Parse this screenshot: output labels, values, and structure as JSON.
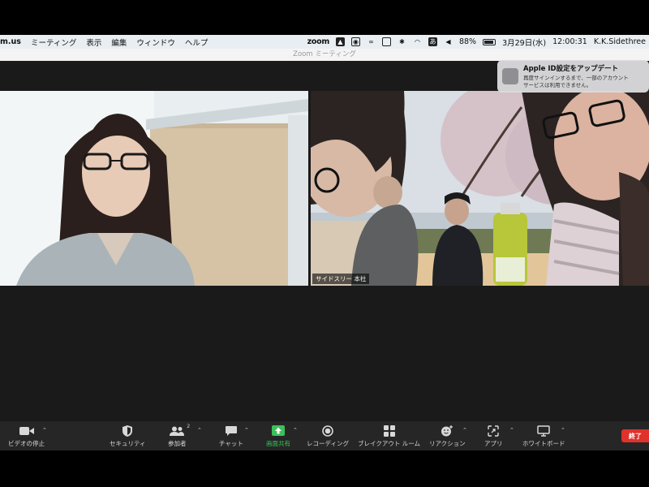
{
  "menubar": {
    "app_name": "m.us",
    "menus": [
      "ミーティング",
      "表示",
      "編集",
      "ウィンドウ",
      "ヘルプ"
    ],
    "status_zoom": "zoom",
    "battery_percent": "88%",
    "battery_level": 0.88,
    "date": "3月29日(水)",
    "time": "12:00:31",
    "user": "K.K.Sidethree"
  },
  "window": {
    "title": "Zoom ミーティング"
  },
  "notification": {
    "title": "Apple ID設定をアップデート",
    "body_line1": "再度サインインするまで、一部のアカウント",
    "body_line2": "サービスは利用できません。"
  },
  "participants": [
    {
      "name": ""
    },
    {
      "name": "サイドスリー 本社"
    }
  ],
  "toolbar": {
    "video_label": "ビデオの停止",
    "security_label": "セキュリティ",
    "participants_label": "参加者",
    "participants_count": "2",
    "chat_label": "チャット",
    "share_label": "画面共有",
    "record_label": "レコーディング",
    "breakout_label": "ブレイクアウト ルーム",
    "reactions_label": "リアクション",
    "apps_label": "アプリ",
    "whiteboard_label": "ホワイトボード",
    "end_label": "終了"
  },
  "colors": {
    "share_green": "#3ac15a",
    "end_red": "#e0312b",
    "toolbar_bg": "#262626",
    "meeting_bg": "#1a1a1a"
  }
}
